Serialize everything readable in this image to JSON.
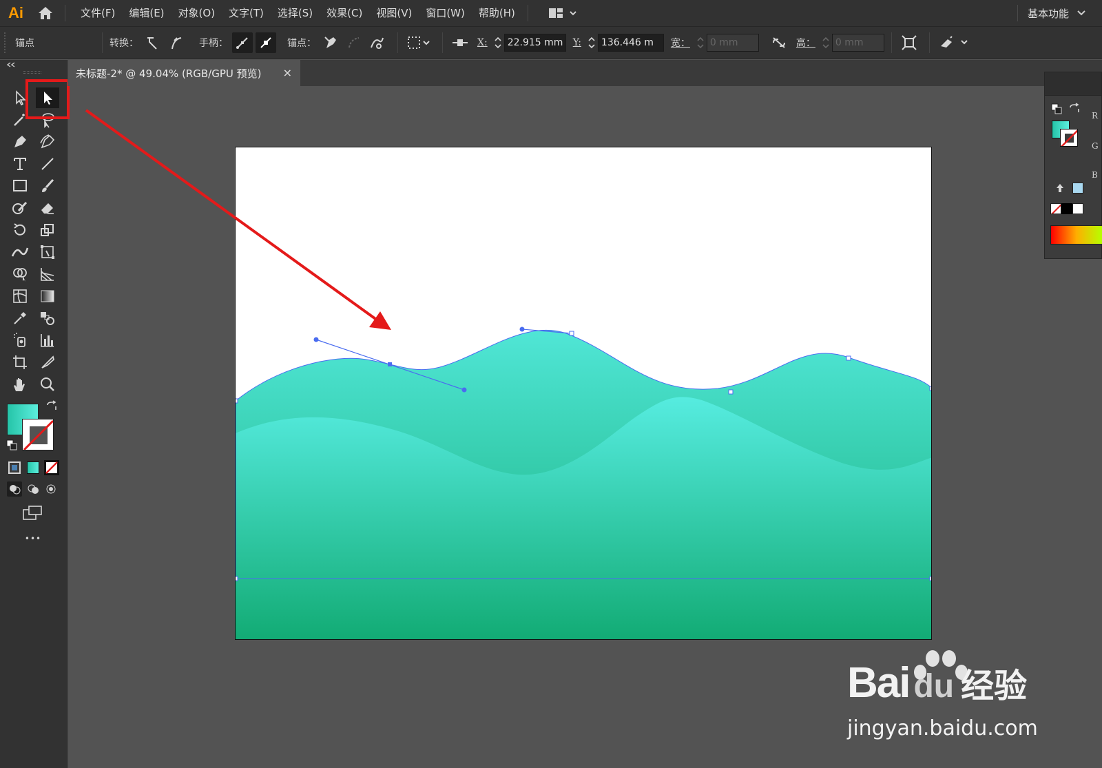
{
  "app": {
    "logo": "Ai",
    "workspace": "基本功能"
  },
  "menu": [
    "文件(F)",
    "编辑(E)",
    "对象(O)",
    "文字(T)",
    "选择(S)",
    "效果(C)",
    "视图(V)",
    "窗口(W)",
    "帮助(H)"
  ],
  "control": {
    "panel_label": "锚点",
    "convert_label": "转换：",
    "handle_label": "手柄：",
    "anchor_label": "锚点：",
    "x_label": "X:",
    "x_value": "22.915 mm",
    "y_label": "Y:",
    "y_value": "136.446 m",
    "w_label": "宽：",
    "w_value": "0 mm",
    "h_label": "高：",
    "h_value": "0 mm"
  },
  "document": {
    "tab_title": "未标题-2* @ 49.04% (RGB/GPU 预览)",
    "close": "×"
  },
  "color_panel": {
    "r": "R",
    "g": "G",
    "b": "B"
  },
  "toolbar": {
    "more": "•••"
  },
  "watermark": {
    "brand": "Bai",
    "brand2": "du",
    "cn": "经验",
    "url": "jingyan.baidu.com"
  },
  "colors": {
    "accent_red": "#e41a1a",
    "wave_top": "#4de3d3",
    "wave_bottom": "#14ad78",
    "path_blue": "#4a6cf0"
  }
}
